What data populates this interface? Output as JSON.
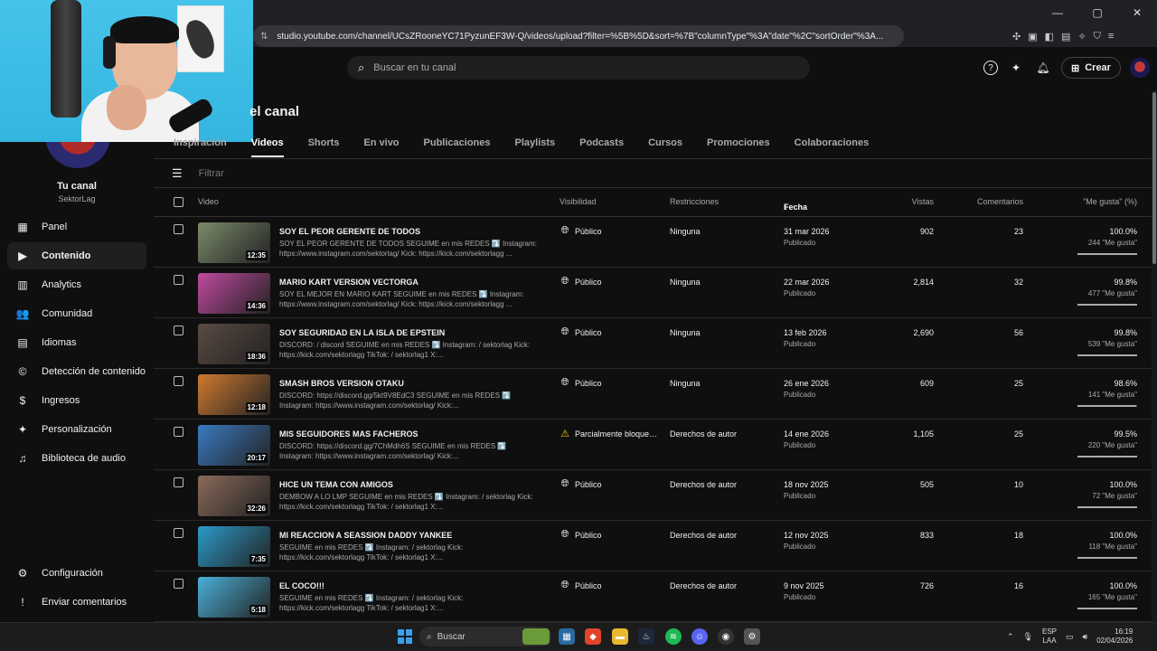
{
  "browser": {
    "url": "studio.youtube.com/channel/UCsZRooneYC71PyzunEF3W-Q/videos/upload?filter=%5B%5D&sort=%7B\"columnType\"%3A\"date\"%2C\"sortOrder\"%3A...",
    "window_controls": [
      "—",
      "▢",
      "✕"
    ]
  },
  "header": {
    "search_placeholder": "Buscar en tu canal",
    "create_label": "Crear"
  },
  "channel": {
    "name": "Tu canal",
    "handle": "SektorLag"
  },
  "sidebar": {
    "items": [
      {
        "label": "Panel",
        "icon": "dashboard-icon",
        "glyph": "▦"
      },
      {
        "label": "Contenido",
        "icon": "content-icon",
        "glyph": "▶"
      },
      {
        "label": "Analytics",
        "icon": "analytics-icon",
        "glyph": "▥"
      },
      {
        "label": "Comunidad",
        "icon": "community-icon",
        "glyph": "👥"
      },
      {
        "label": "Idiomas",
        "icon": "subtitles-icon",
        "glyph": "▤"
      },
      {
        "label": "Detección de contenido",
        "icon": "copyright-icon",
        "glyph": "©"
      },
      {
        "label": "Ingresos",
        "icon": "money-icon",
        "glyph": "$"
      },
      {
        "label": "Personalización",
        "icon": "magic-wand-icon",
        "glyph": "✦"
      },
      {
        "label": "Biblioteca de audio",
        "icon": "audio-library-icon",
        "glyph": "♫"
      }
    ],
    "bottom": [
      {
        "label": "Configuración",
        "icon": "gear-icon",
        "glyph": "⚙"
      },
      {
        "label": "Enviar comentarios",
        "icon": "feedback-icon",
        "glyph": "!"
      }
    ]
  },
  "main": {
    "title": "el canal",
    "tabs": [
      "Inspiración",
      "Videos",
      "Shorts",
      "En vivo",
      "Publicaciones",
      "Playlists",
      "Podcasts",
      "Cursos",
      "Promociones",
      "Colaboraciones"
    ],
    "active_tab": "Videos",
    "filter_placeholder": "Filtrar",
    "columns": {
      "video": "Video",
      "visibility": "Visibilidad",
      "restrictions": "Restricciones",
      "date": "Fecha",
      "views": "Vistas",
      "comments": "Comentarios",
      "likes": "\"Me gusta\" (%)"
    },
    "rows": [
      {
        "title": "SOY EL PEOR GERENTE DE TODOS",
        "desc": "SOY EL PEOR GERENTE DE TODOS SEGUIME en mis REDES ⤵️ Instagram: https://www.instagram.com/sektorlag/ Kick: https://kick.com/sektorlagg ...",
        "duration": "12:35",
        "visibility": "Público",
        "vis_icon": "globe-icon",
        "restrictions": "Ninguna",
        "date": "31 mar 2026",
        "date_sub": "Publicado",
        "views": "902",
        "comments": "23",
        "likes_pct": "100.0%",
        "likes_count": "244 \"Me gusta\"",
        "likes_ratio": 1.0,
        "thumb": "#7a8a6a"
      },
      {
        "title": "MARIO KART VERSION VECTORGA",
        "desc": "SOY EL MEJOR EN MARIO KART SEGUIME en mis REDES ⤵️ Instagram: https://www.instagram.com/sektorlag/ Kick: https://kick.com/sektorlagg ...",
        "duration": "14:36",
        "visibility": "Público",
        "vis_icon": "globe-icon",
        "restrictions": "Ninguna",
        "date": "22 mar 2026",
        "date_sub": "Publicado",
        "views": "2,814",
        "comments": "32",
        "likes_pct": "99.8%",
        "likes_count": "477 \"Me gusta\"",
        "likes_ratio": 0.998,
        "thumb": "#c04aa0"
      },
      {
        "title": "SOY SEGURIDAD EN LA ISLA DE EPSTEIN",
        "desc": "DISCORD: / discord SEGUIME en mis REDES ⤵️ Instagram: / sektorlag Kick: https://kick.com/sektorlagg TikTok: / sektorlag1 X:...",
        "duration": "18:36",
        "visibility": "Público",
        "vis_icon": "globe-icon",
        "restrictions": "Ninguna",
        "date": "13 feb 2026",
        "date_sub": "Publicado",
        "views": "2,690",
        "comments": "56",
        "likes_pct": "99.8%",
        "likes_count": "539 \"Me gusta\"",
        "likes_ratio": 0.998,
        "thumb": "#5a4a42"
      },
      {
        "title": "SMASH BROS VERSION OTAKU",
        "desc": "DISCORD: https://discord.gg/5kt9V8EdC3 SEGUIME en mis REDES ⤵️ Instagram: https://www.instagram.com/sektorlag/ Kick:...",
        "duration": "12:18",
        "visibility": "Público",
        "vis_icon": "globe-icon",
        "restrictions": "Ninguna",
        "date": "26 ene 2026",
        "date_sub": "Publicado",
        "views": "609",
        "comments": "25",
        "likes_pct": "98.6%",
        "likes_count": "141 \"Me gusta\"",
        "likes_ratio": 0.986,
        "thumb": "#d07a30"
      },
      {
        "title": "MIS SEGUIDORES MAS FACHEROS",
        "desc": "DISCORD: https://discord.gg/7ChMdh6S SEGUIME en mis REDES ⤵️ Instagram: https://www.instagram.com/sektorlag/ Kick:...",
        "duration": "20:17",
        "visibility": "Parcialmente bloqueado",
        "vis_icon": "warning-icon",
        "restrictions": "Derechos de autor",
        "date": "14 ene 2026",
        "date_sub": "Publicado",
        "views": "1,105",
        "comments": "25",
        "likes_pct": "99.5%",
        "likes_count": "220 \"Me gusta\"",
        "likes_ratio": 0.995,
        "thumb": "#3a7ac0"
      },
      {
        "title": "HICE UN TEMA CON AMIGOS",
        "desc": "DEMBOW A LO LMP SEGUIME en mis REDES ⤵️ Instagram: / sektorlag Kick: https://kick.com/sektorlagg TikTok: / sektorlag1 X:...",
        "duration": "32:26",
        "visibility": "Público",
        "vis_icon": "globe-icon",
        "restrictions": "Derechos de autor",
        "date": "18 nov 2025",
        "date_sub": "Publicado",
        "views": "505",
        "comments": "10",
        "likes_pct": "100.0%",
        "likes_count": "72 \"Me gusta\"",
        "likes_ratio": 1.0,
        "thumb": "#8a6a5a"
      },
      {
        "title": "MI REACCION A SEASSION DADDY YANKEE",
        "desc": "SEGUIME en mis REDES ⤵️ Instagram: / sektorlag Kick: https://kick.com/sektorlagg TikTok: / sektorlag1 X:...",
        "duration": "7:35",
        "visibility": "Público",
        "vis_icon": "globe-icon",
        "restrictions": "Derechos de autor",
        "date": "12 nov 2025",
        "date_sub": "Publicado",
        "views": "833",
        "comments": "18",
        "likes_pct": "100.0%",
        "likes_count": "118 \"Me gusta\"",
        "likes_ratio": 1.0,
        "thumb": "#2a9ac8"
      },
      {
        "title": "EL COCO!!!",
        "desc": "SEGUIME en mis REDES ⤵️ Instagram: / sektorlag Kick: https://kick.com/sektorlagg TikTok: / sektorlag1 X:...",
        "duration": "5:18",
        "visibility": "Público",
        "vis_icon": "globe-icon",
        "restrictions": "Derechos de autor",
        "date": "9 nov 2025",
        "date_sub": "Publicado",
        "views": "726",
        "comments": "16",
        "likes_pct": "100.0%",
        "likes_count": "165 \"Me gusta\"",
        "likes_ratio": 1.0,
        "thumb": "#4ab0d8"
      }
    ]
  },
  "taskbar": {
    "search_label": "Buscar",
    "lang_top": "ESP",
    "lang_bottom": "LAA",
    "time": "16:19",
    "date": "02/04/2026"
  },
  "colors": {
    "background": "#0f0f0f",
    "accent": "#3ea6ff",
    "warning": "#ffcc00"
  }
}
